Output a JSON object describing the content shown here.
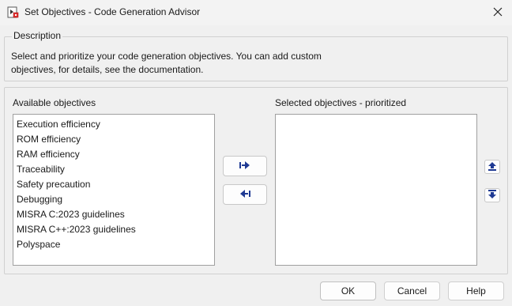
{
  "window": {
    "title": "Set Objectives - Code Generation Advisor",
    "app_icon": "simulink-model-icon",
    "close_icon": "close-icon"
  },
  "description": {
    "heading": "Description",
    "line1": "Select and prioritize your code generation objectives. You can add custom",
    "line2": "objectives, for details, see the documentation."
  },
  "available": {
    "label": "Available objectives",
    "items": [
      "Execution efficiency",
      "ROM efficiency",
      "RAM efficiency",
      "Traceability",
      "Safety precaution",
      "Debugging",
      "MISRA C:2023 guidelines",
      "MISRA C++:2023 guidelines",
      "Polyspace"
    ]
  },
  "selected": {
    "label": "Selected objectives - prioritized",
    "items": []
  },
  "buttons": {
    "add_icon": "arrow-right-icon",
    "remove_icon": "arrow-left-icon",
    "move_up_icon": "move-up-icon",
    "move_down_icon": "move-down-icon",
    "ok": "OK",
    "cancel": "Cancel",
    "help": "Help"
  },
  "colors": {
    "icon_blue": "#1f3a93",
    "background": "#f0f0f0",
    "list_border": "#a0a0a0"
  }
}
